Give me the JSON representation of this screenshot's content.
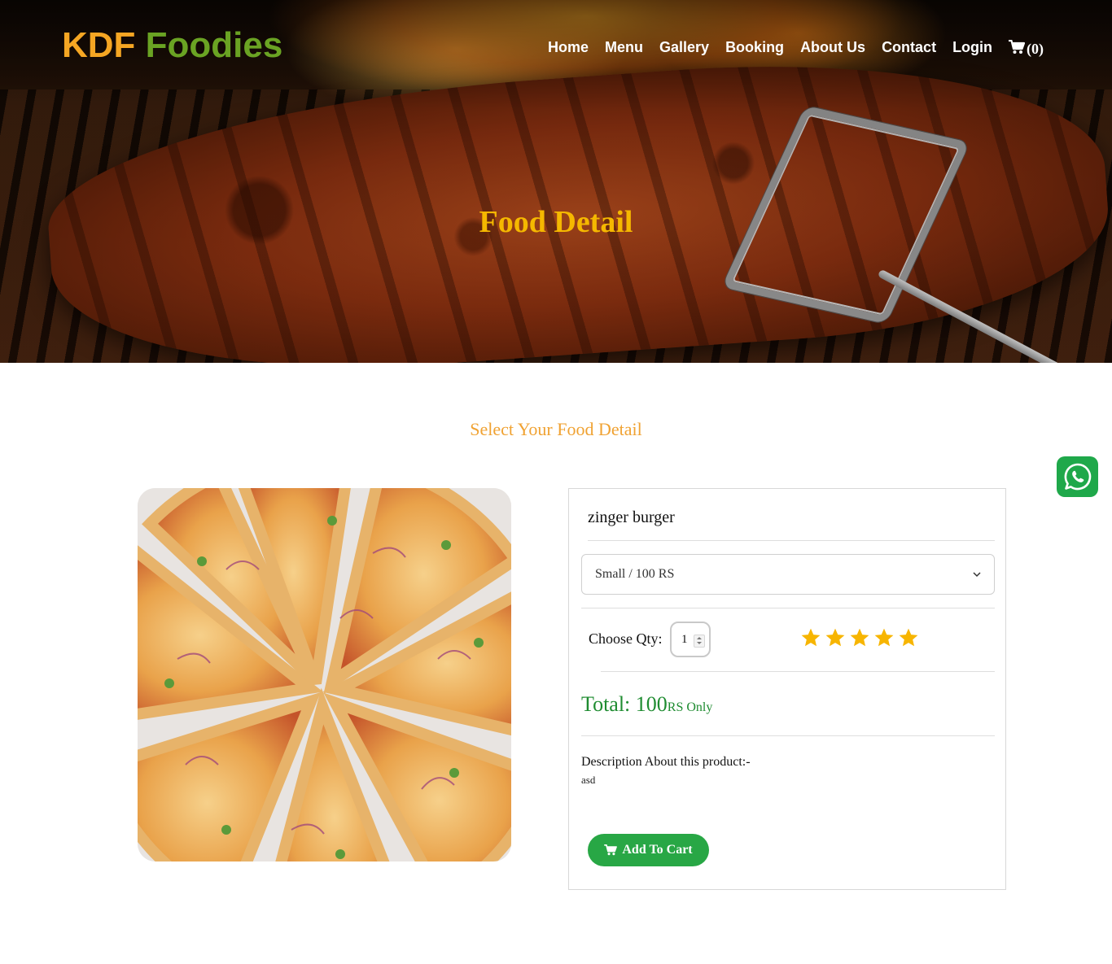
{
  "brand": {
    "part1": "KDF",
    "part2": "Foodies"
  },
  "nav": {
    "items": [
      "Home",
      "Menu",
      "Gallery",
      "Booking",
      "About Us",
      "Contact",
      "Login"
    ],
    "cart_count": "(0)"
  },
  "hero": {
    "title": "Food Detail"
  },
  "section": {
    "title": "Select Your Food Detail"
  },
  "product": {
    "name": "zinger burger",
    "size_selected": "Small / 100 RS",
    "qty_label": "Choose Qty:",
    "qty_value": "1",
    "rating": 5,
    "total_label": "Total: 100",
    "total_unit": "RS Only",
    "description_label": "Description About this product:-",
    "description": "asd",
    "add_button": "Add To Cart"
  },
  "colors": {
    "brand_orange": "#f5a623",
    "brand_green": "#6aa323",
    "hero_title": "#f5b800",
    "section_title": "#f0a232",
    "star": "#f7b500",
    "total_green": "#1f8c31",
    "button_green": "#28a745",
    "whatsapp_green": "#1fa84a"
  },
  "icons": {
    "cart": "shopping-cart-icon",
    "star": "star-icon",
    "whatsapp": "whatsapp-icon",
    "chevron": "chevron-down-icon"
  }
}
